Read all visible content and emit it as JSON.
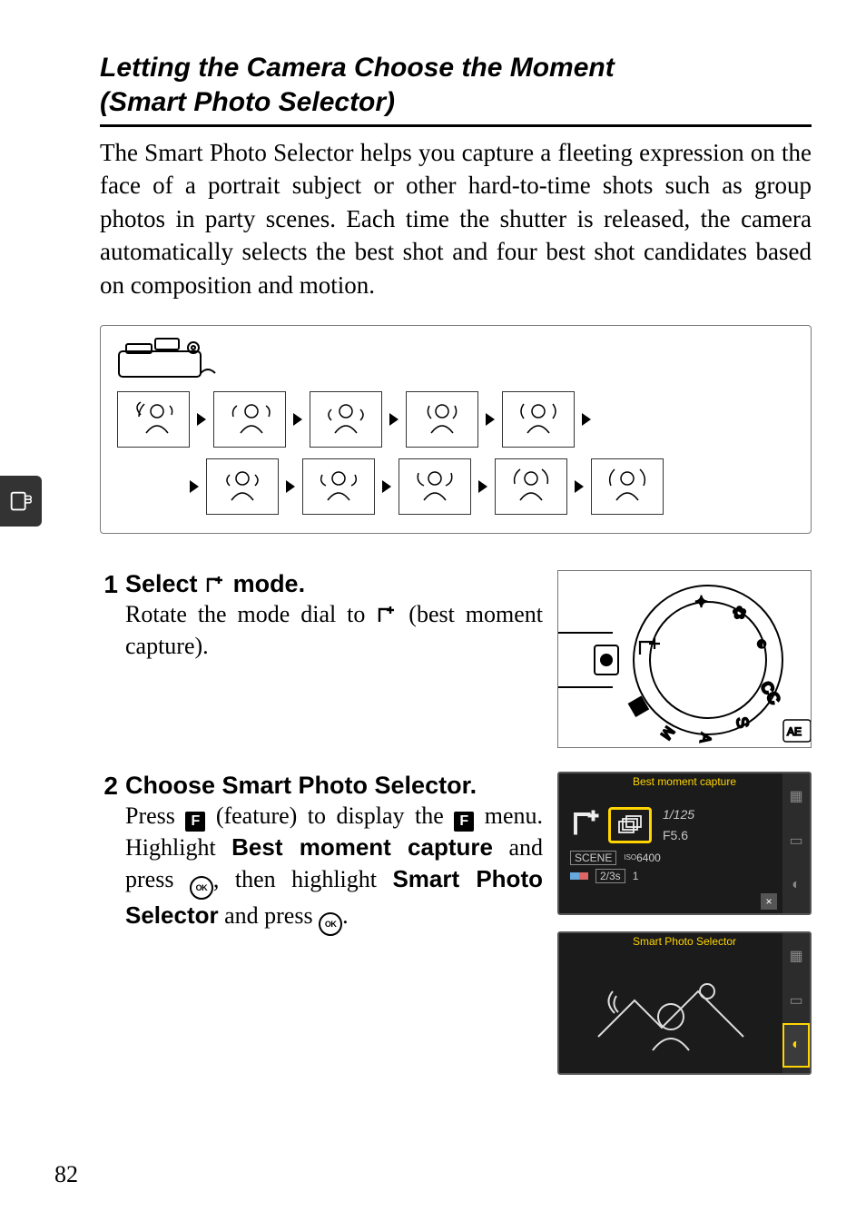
{
  "page_number": "82",
  "heading": {
    "line1": "Letting the Camera Choose the Moment",
    "line2": "(Smart Photo Selector)"
  },
  "intro_text": "The Smart Photo Selector helps you capture a fleeting expression on the face of a portrait subject or other hard-to-time shots such as group photos in party scenes. Each time the shutter is released, the camera automatically selects the best shot and four best shot candidates based on composition and motion.",
  "steps": [
    {
      "num": "1",
      "title_before_icon": "Select ",
      "title_after_icon": " mode.",
      "text_before_icon": "Rotate the mode dial to ",
      "text_after_icon": " (best moment capture).",
      "mode_icon_name": "best-moment-capture-icon"
    },
    {
      "num": "2",
      "title": "Choose Smart Photo Selector.",
      "parts": {
        "a": "Press ",
        "b": " (feature) to display the ",
        "c": " menu. Highlight ",
        "d": "Best moment capture",
        "e": " and press ",
        "f": ", then highlight ",
        "g": "Smart Photo Selector",
        "h": " and press ",
        "i": "."
      }
    }
  ],
  "screen1": {
    "title": "Best moment capture",
    "shutter": "1/125",
    "aperture": "F5.6",
    "scene_label": "SCENE",
    "iso_label": "ISO",
    "iso_value": "6400",
    "ev_value": "2/3s",
    "count": "1",
    "close": "×"
  },
  "screen2": {
    "title": "Smart Photo Selector"
  },
  "icons": {
    "feature_button": "F",
    "ok_button": "OK"
  }
}
